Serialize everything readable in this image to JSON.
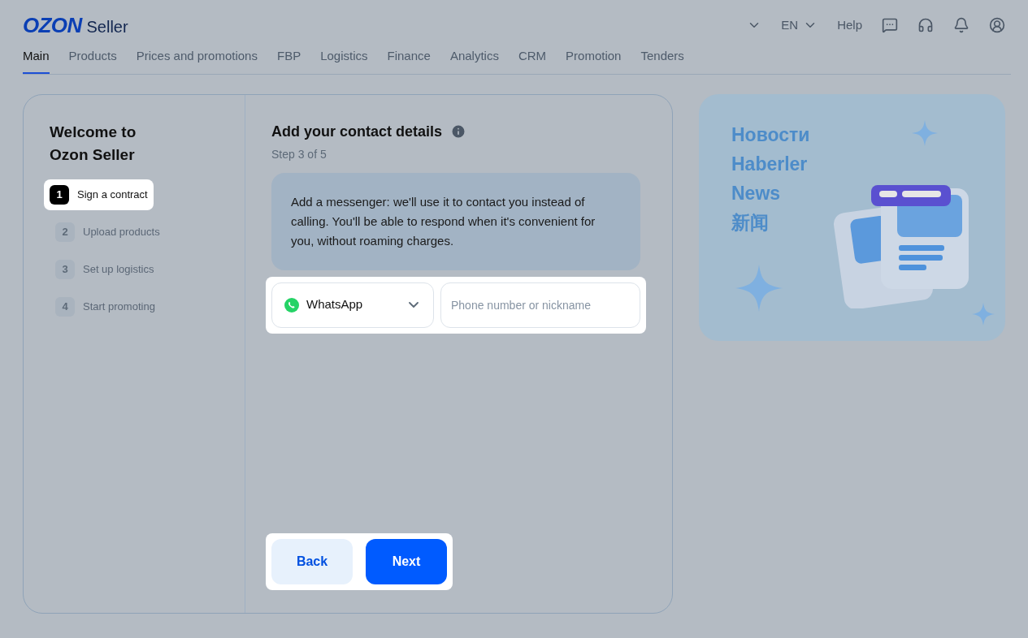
{
  "brand": {
    "logo": "OZON",
    "product": "Seller"
  },
  "header": {
    "language": "EN",
    "help": "Help"
  },
  "nav": [
    {
      "label": "Main",
      "selected": true
    },
    {
      "label": "Products",
      "selected": false
    },
    {
      "label": "Prices and promotions",
      "selected": false
    },
    {
      "label": "FBP",
      "selected": false
    },
    {
      "label": "Logistics",
      "selected": false
    },
    {
      "label": "Finance",
      "selected": false
    },
    {
      "label": "Analytics",
      "selected": false
    },
    {
      "label": "CRM",
      "selected": false
    },
    {
      "label": "Promotion",
      "selected": false
    },
    {
      "label": "Tenders",
      "selected": false
    }
  ],
  "steps_panel": {
    "title": "Welcome to Ozon Seller",
    "steps": [
      {
        "number": "1",
        "label": "Sign a contract",
        "selected": true
      },
      {
        "number": "2",
        "label": "Upload products",
        "selected": false
      },
      {
        "number": "3",
        "label": "Set up logistics",
        "selected": false
      },
      {
        "number": "4",
        "label": "Start promoting",
        "selected": false
      }
    ]
  },
  "form": {
    "title": "Add your contact details",
    "step": "Step 3 of 5",
    "info": "Add a messenger: we'll use it to contact you instead of calling. You'll be able to respond when it's convenient for you, without roaming charges.",
    "messenger": "WhatsApp",
    "contact_placeholder": "Phone number or nickname",
    "back": "Back",
    "next": "Next"
  },
  "news": {
    "headings": [
      "Новости",
      "Haberler",
      "News",
      "新闻"
    ]
  }
}
